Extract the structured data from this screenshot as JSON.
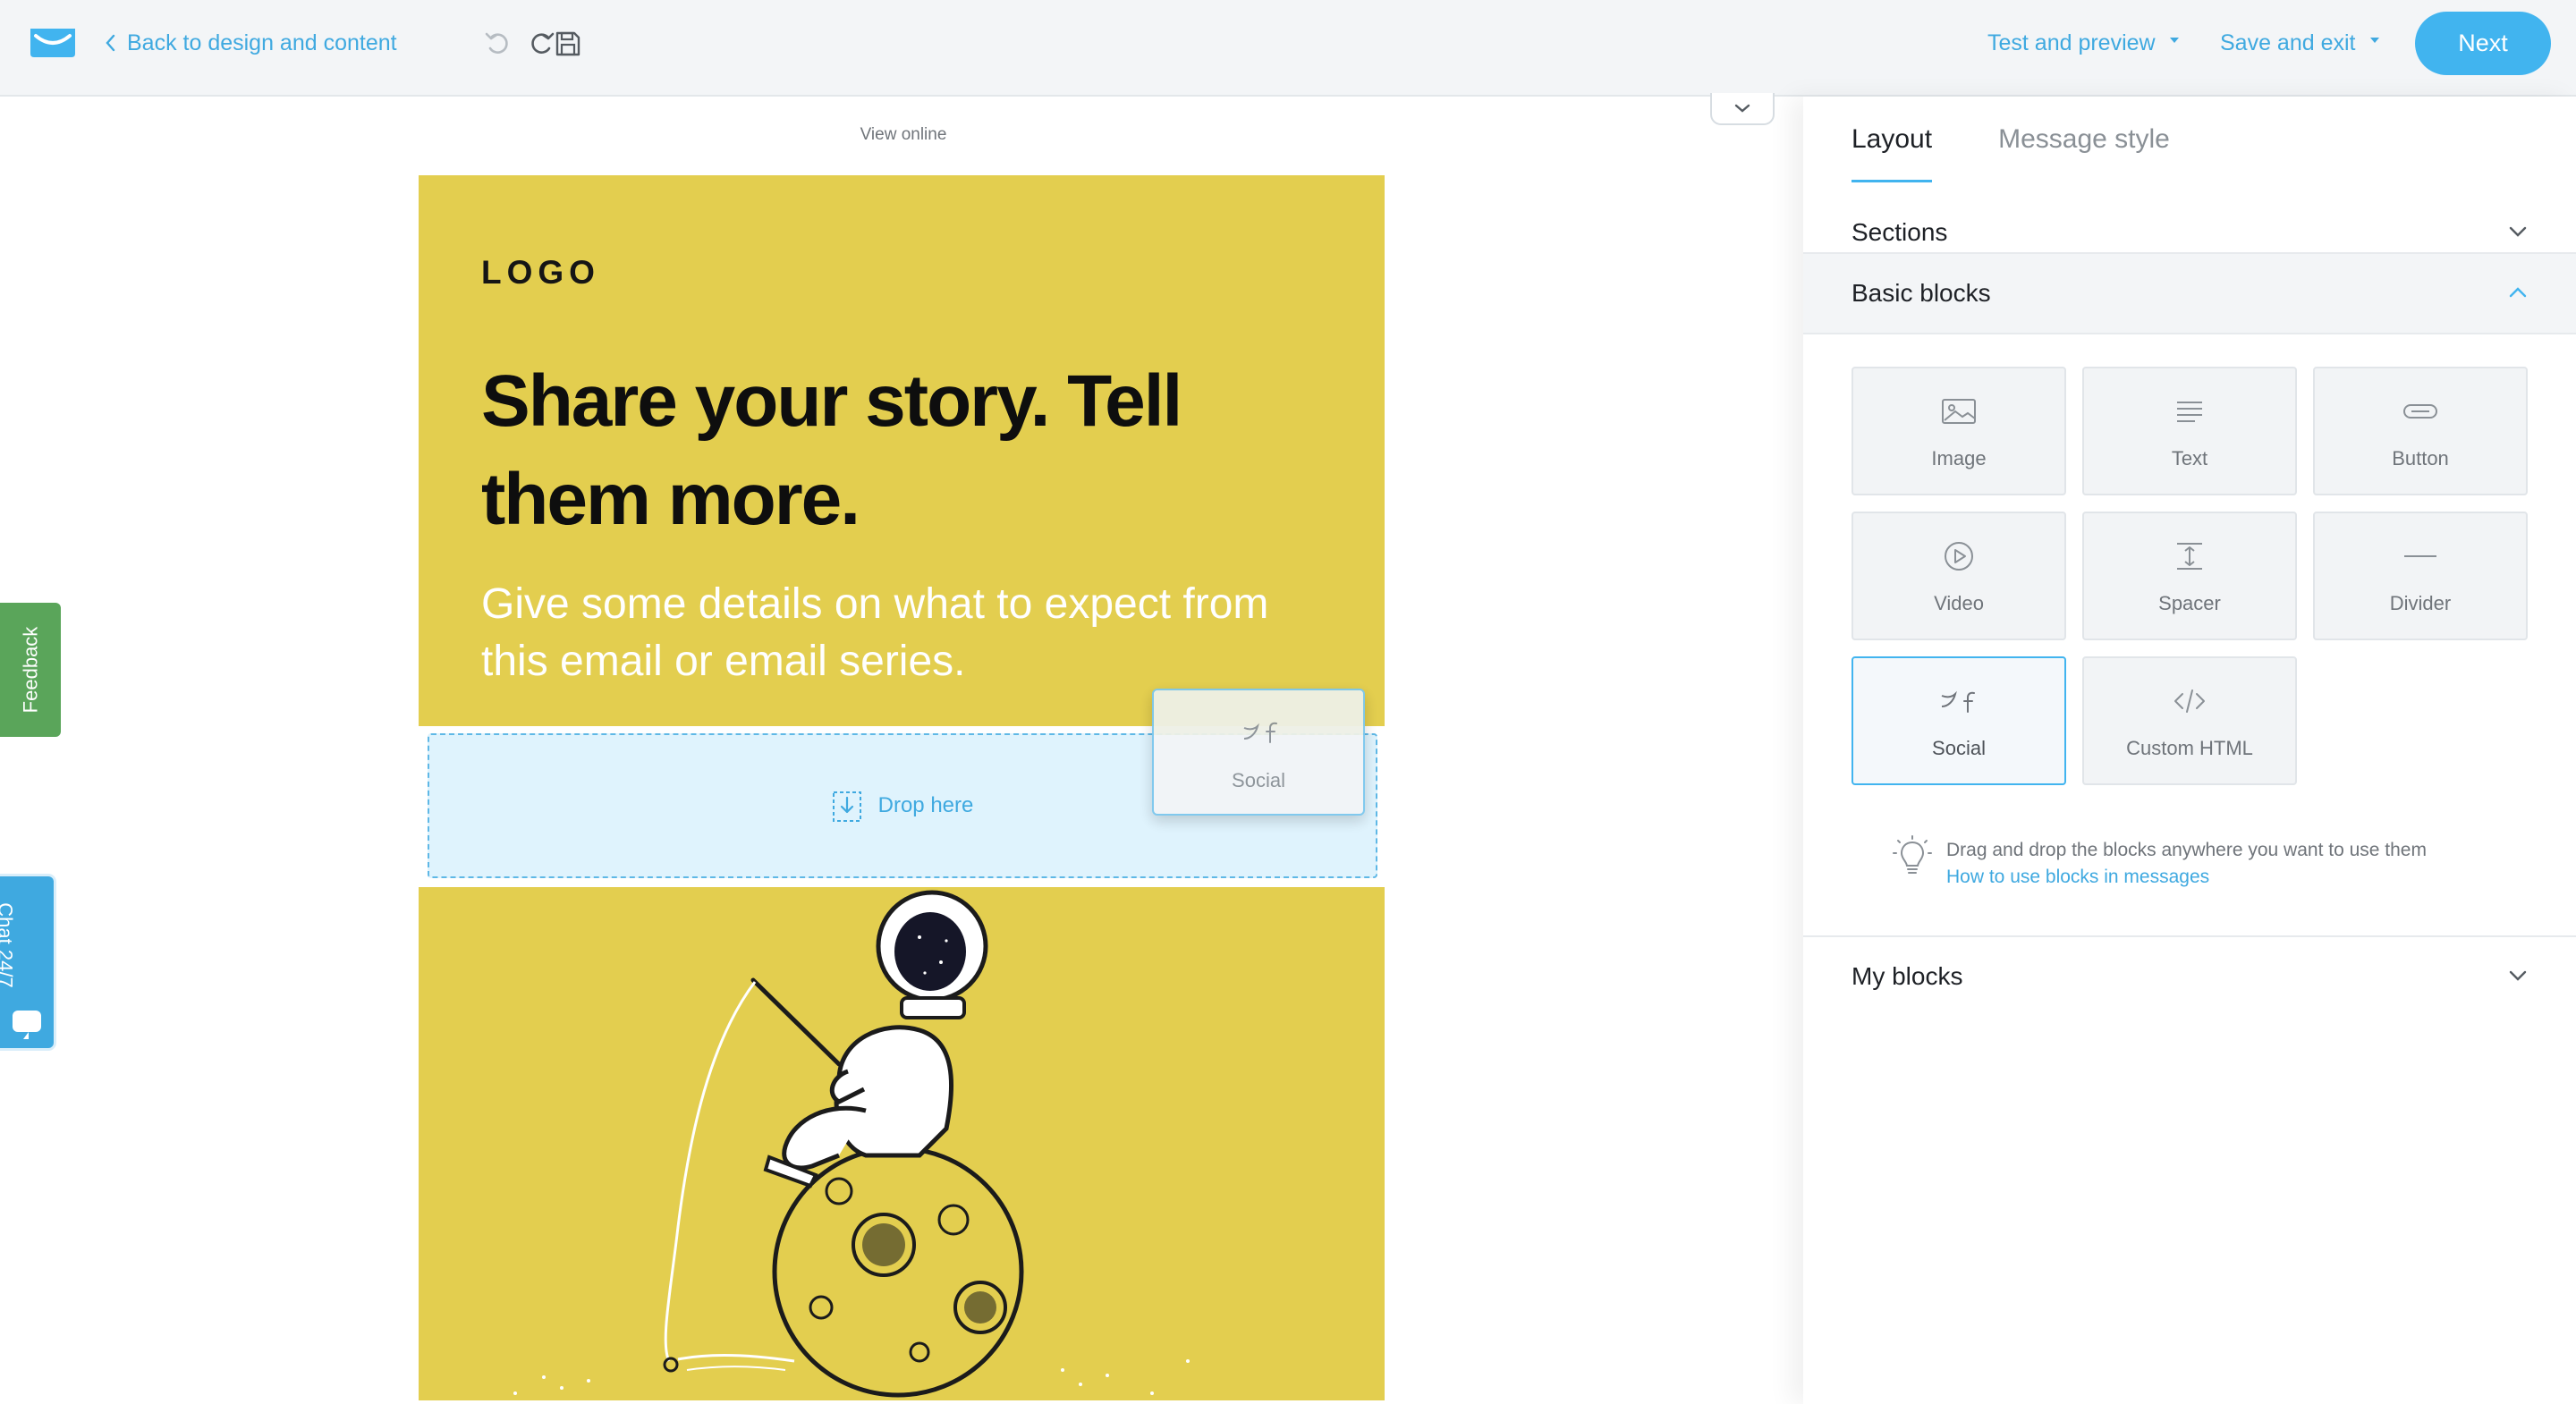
{
  "header": {
    "back_label": "Back to design and content",
    "test_label": "Test and preview",
    "save_label": "Save and exit",
    "next_label": "Next"
  },
  "canvas": {
    "view_online": "View online",
    "hero": {
      "logo": "LOGO",
      "title": "Share your story. Tell them more.",
      "subtitle": "Give some details on what to expect from this email or email series."
    },
    "dropzone_label": "Drop here",
    "drag_ghost_label": "Social"
  },
  "side_tabs": {
    "feedback": "Feedback",
    "chat": "Chat 24/7"
  },
  "panel": {
    "tabs": [
      "Layout",
      "Message style"
    ],
    "active_tab": "Layout",
    "sections_label": "Sections",
    "basic_blocks_label": "Basic blocks",
    "my_blocks_label": "My blocks",
    "blocks": [
      {
        "label": "Image",
        "icon": "image-icon"
      },
      {
        "label": "Text",
        "icon": "text-icon"
      },
      {
        "label": "Button",
        "icon": "button-icon"
      },
      {
        "label": "Video",
        "icon": "video-icon"
      },
      {
        "label": "Spacer",
        "icon": "spacer-icon"
      },
      {
        "label": "Divider",
        "icon": "divider-icon"
      },
      {
        "label": "Social",
        "icon": "social-icon"
      },
      {
        "label": "Custom HTML",
        "icon": "code-icon"
      }
    ],
    "hint_text": "Drag and drop the blocks anywhere you want to use them",
    "hint_link": "How to use blocks in messages"
  },
  "colors": {
    "accent": "#41b4ef",
    "hero_bg": "#e3ce4f",
    "feedback": "#5aa55a",
    "dropzone_bg": "#dff3fd"
  }
}
